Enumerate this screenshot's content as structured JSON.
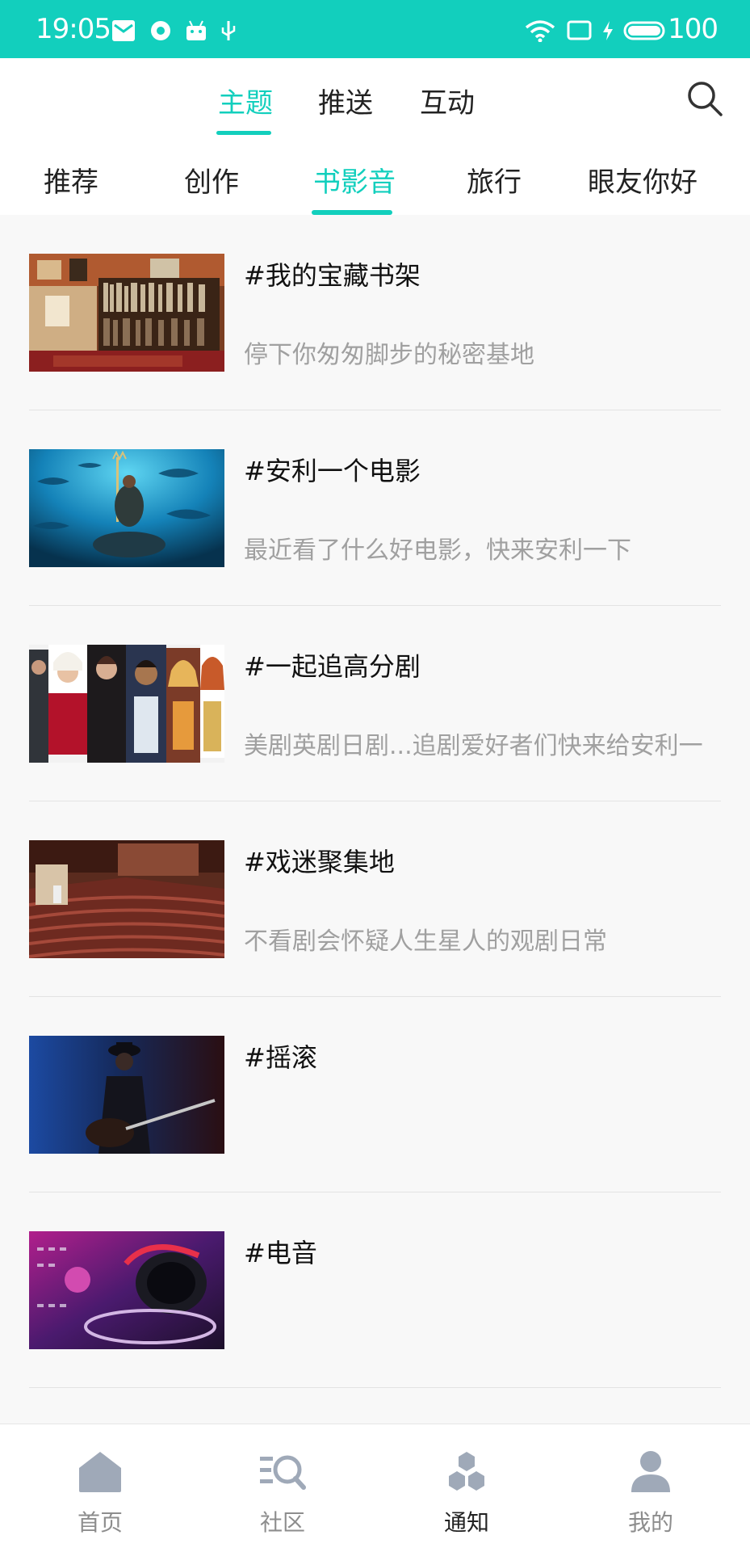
{
  "status_bar": {
    "time": "19:05",
    "battery": "100",
    "bg_color": "#12cfbd"
  },
  "top_tabs": [
    {
      "label": "主题",
      "active": true
    },
    {
      "label": "推送",
      "active": false
    },
    {
      "label": "互动",
      "active": false
    }
  ],
  "sub_tabs": [
    {
      "label": "推荐",
      "active": false
    },
    {
      "label": "创作",
      "active": false
    },
    {
      "label": "书影音",
      "active": true
    },
    {
      "label": "旅行",
      "active": false
    },
    {
      "label": "眼友你好",
      "active": false
    }
  ],
  "topics": [
    {
      "title": "#我的宝藏书架",
      "subtitle": "停下你匆匆脚步的秘密基地",
      "image": "bookshelf-photo"
    },
    {
      "title": "#安利一个电影",
      "subtitle": "最近看了什么好电影，快来安利一下",
      "image": "underwater-movie-poster"
    },
    {
      "title": "#一起追高分剧",
      "subtitle": "美剧英剧日剧...追剧爱好者们快来给安利一",
      "image": "tv-series-collage"
    },
    {
      "title": "#戏迷聚集地",
      "subtitle": "不看剧会怀疑人生星人的观剧日常",
      "image": "theater-seats-photo"
    },
    {
      "title": "#摇滚",
      "subtitle": "",
      "image": "rock-guitarist-photo"
    },
    {
      "title": "#电音",
      "subtitle": "",
      "image": "dj-headphones-photo"
    }
  ],
  "bottom_nav": [
    {
      "label": "首页",
      "icon": "home-icon",
      "active": false
    },
    {
      "label": "社区",
      "icon": "community-icon",
      "active": false
    },
    {
      "label": "通知",
      "icon": "hexagon-cluster-icon",
      "active": true
    },
    {
      "label": "我的",
      "icon": "person-icon",
      "active": false
    }
  ],
  "colors": {
    "accent": "#12cfbd",
    "nav_inactive": "#8d8d8d",
    "subtitle": "#a0a0a0"
  }
}
